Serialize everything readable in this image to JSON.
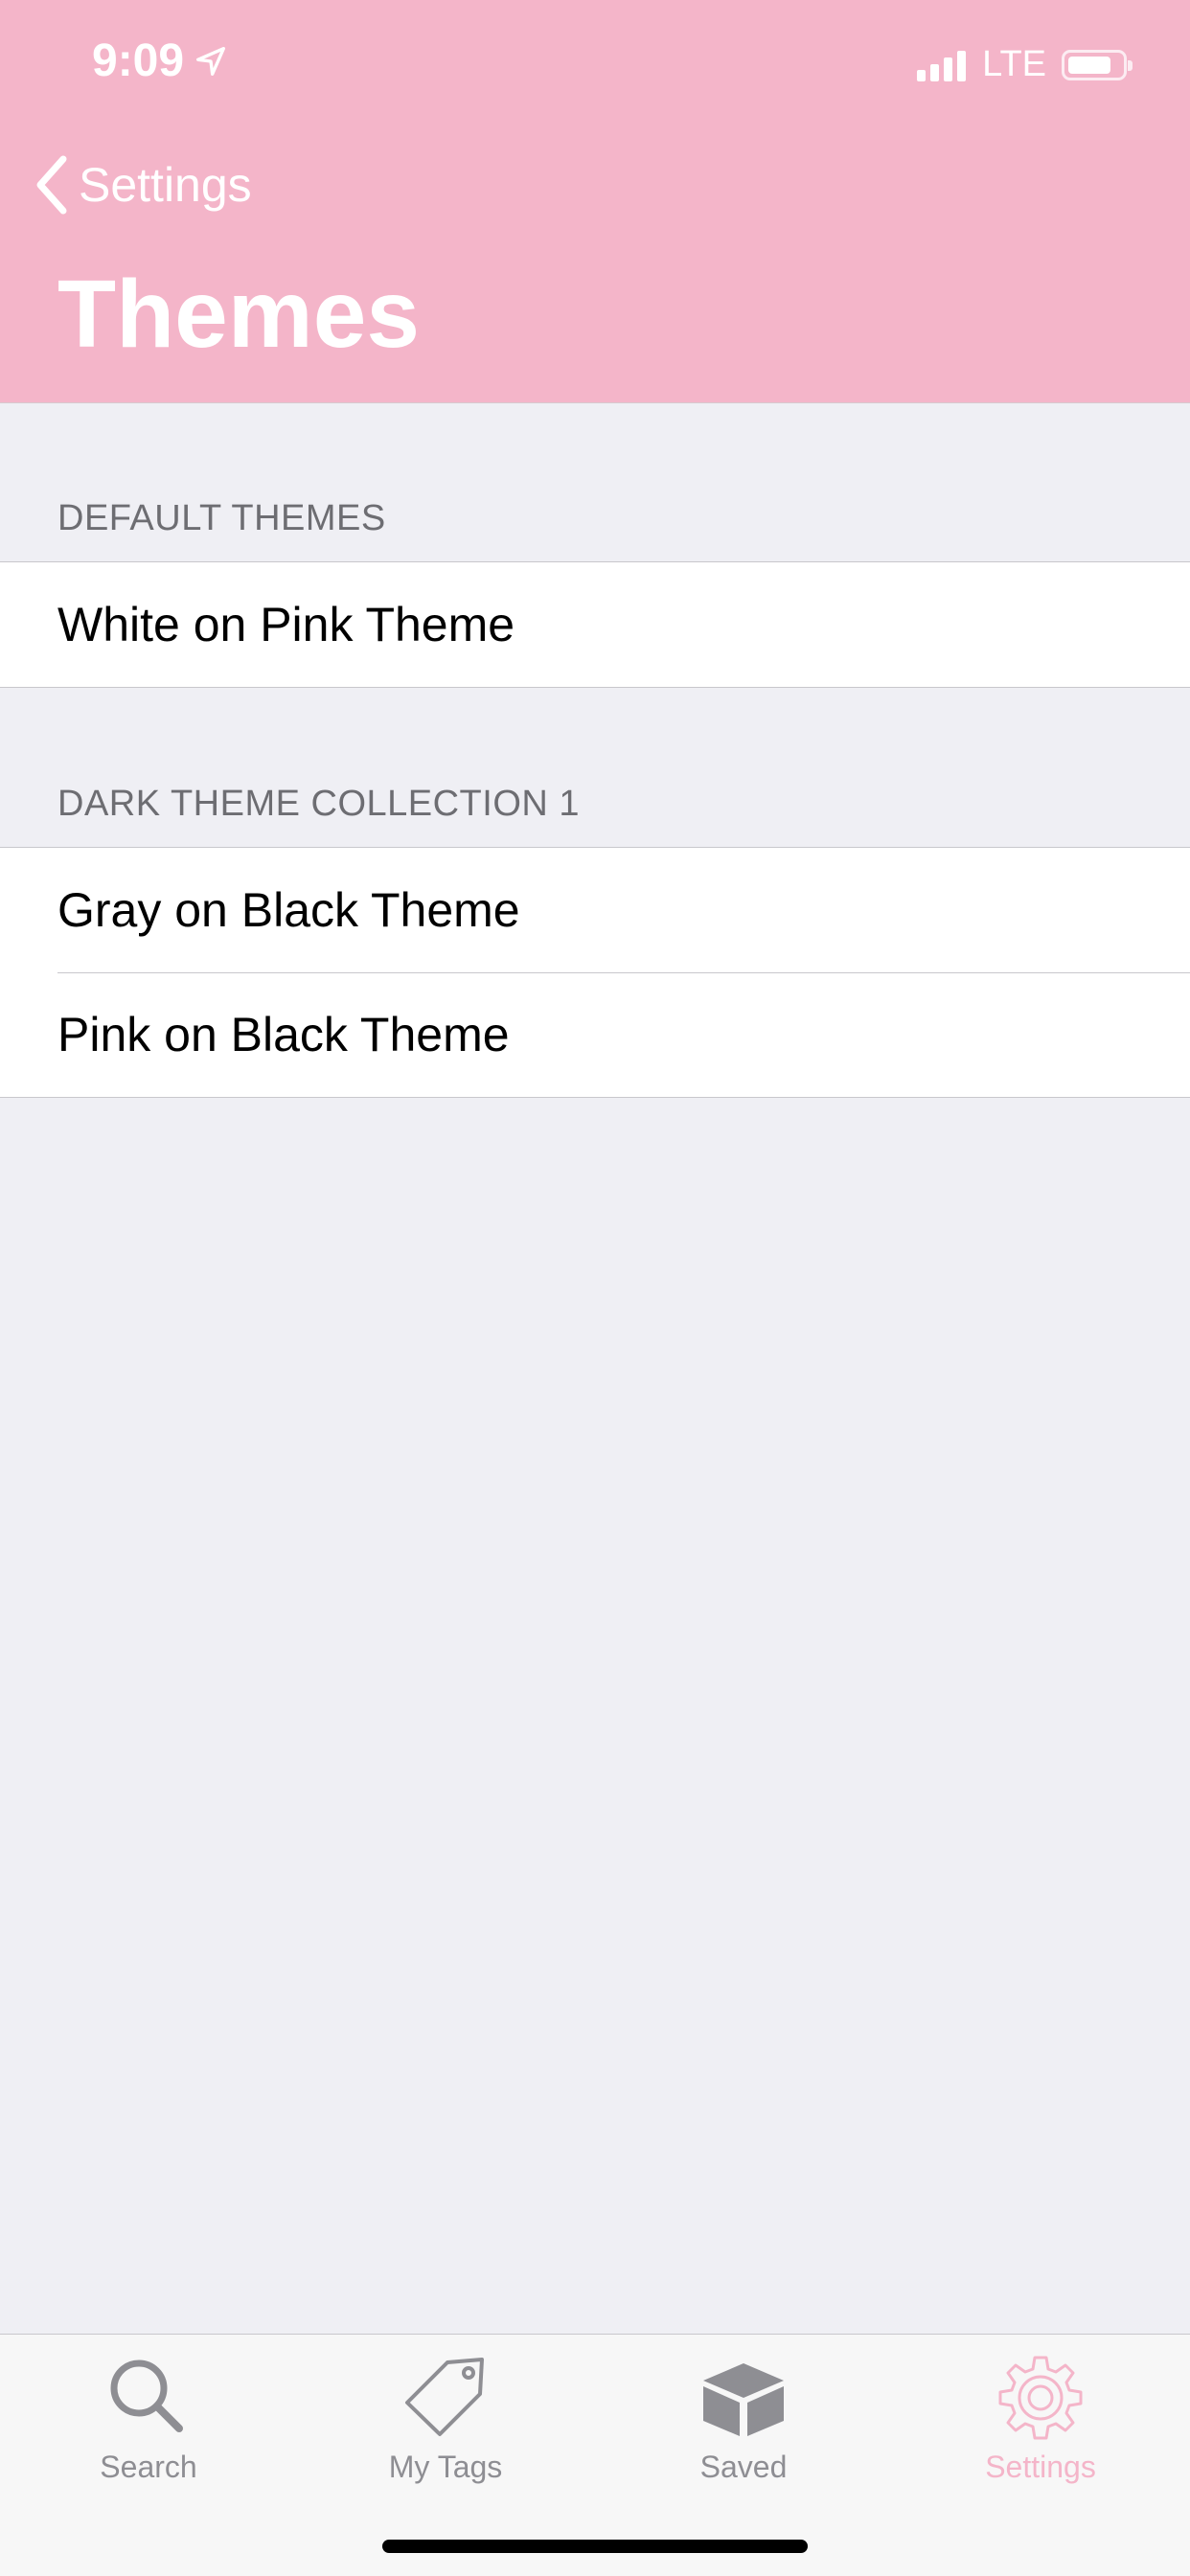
{
  "status_bar": {
    "time": "9:09",
    "network": "LTE",
    "battery_level": 0.75,
    "signal_bars": 4
  },
  "nav": {
    "back_label": "Settings",
    "title": "Themes"
  },
  "sections": [
    {
      "header": "DEFAULT THEMES",
      "rows": [
        "White on Pink Theme"
      ]
    },
    {
      "header": "DARK THEME COLLECTION 1",
      "rows": [
        "Gray on Black Theme",
        "Pink on Black Theme"
      ]
    }
  ],
  "tabbar": {
    "items": [
      {
        "label": "Search",
        "icon": "search-icon"
      },
      {
        "label": "My Tags",
        "icon": "tag-icon"
      },
      {
        "label": "Saved",
        "icon": "box-icon"
      },
      {
        "label": "Settings",
        "icon": "gear-icon"
      }
    ],
    "active_index": 3
  },
  "colors": {
    "accent": "#f4b5c9",
    "background": "#efeff4",
    "tab_inactive": "#8e8e93"
  }
}
